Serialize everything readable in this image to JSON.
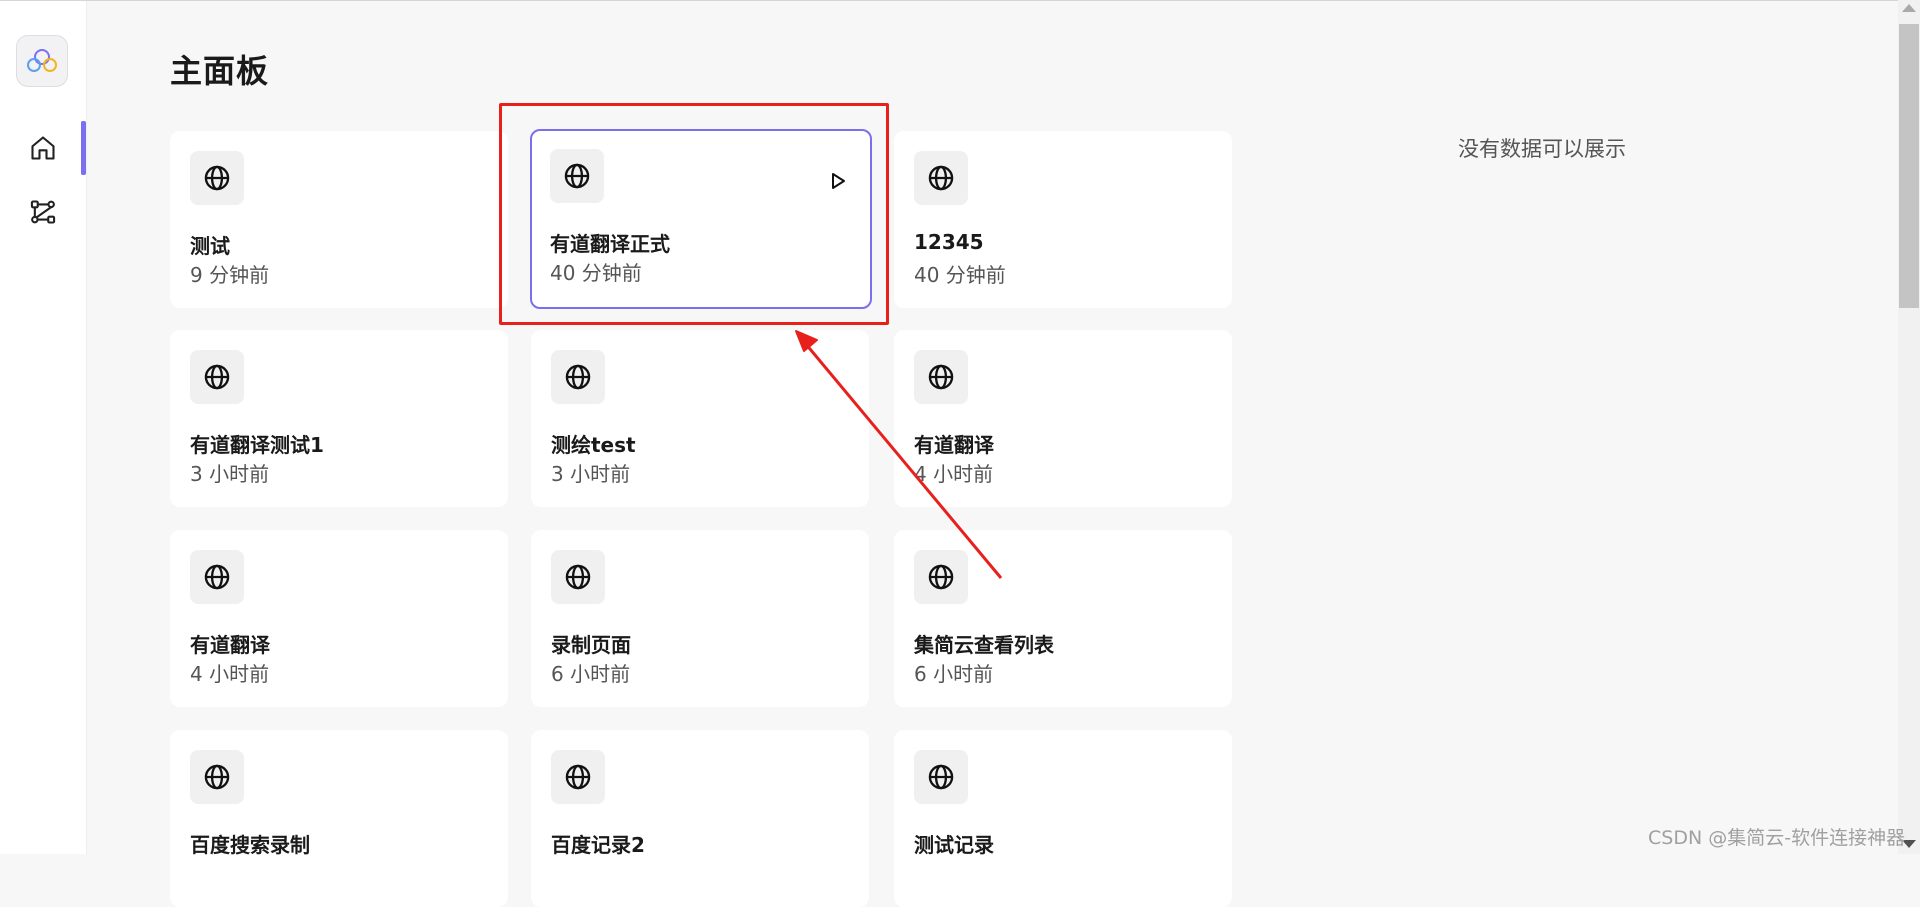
{
  "app": {
    "page_title": "主面板",
    "nav": [
      {
        "icon": "home-icon",
        "active": true
      },
      {
        "icon": "workflow-icon",
        "active": false
      }
    ]
  },
  "empty_state": "没有数据可以展示",
  "cards": [
    {
      "name": "测试",
      "time": "9 分钟前",
      "icon": "globe-icon"
    },
    {
      "name": "有道翻译正式",
      "time": "40 分钟前",
      "icon": "globe-icon",
      "selected": true,
      "action_icon": "play-icon"
    },
    {
      "name": "12345",
      "time": "40 分钟前",
      "icon": "globe-icon"
    },
    {
      "name": "有道翻译测试1",
      "time": "3 小时前",
      "icon": "globe-icon"
    },
    {
      "name": "测绘test",
      "time": "3 小时前",
      "icon": "globe-icon"
    },
    {
      "name": "有道翻译",
      "time": "4 小时前",
      "icon": "globe-icon"
    },
    {
      "name": "有道翻译",
      "time": "4 小时前",
      "icon": "globe-icon"
    },
    {
      "name": "录制页面",
      "time": "6 小时前",
      "icon": "globe-icon"
    },
    {
      "name": "集简云查看列表",
      "time": "6 小时前",
      "icon": "globe-icon"
    },
    {
      "name": "百度搜索录制",
      "time": "",
      "icon": "globe-icon"
    },
    {
      "name": "百度记录2",
      "time": "",
      "icon": "globe-icon"
    },
    {
      "name": "测试记录",
      "time": "",
      "icon": "globe-icon"
    }
  ],
  "watermark": "CSDN @集简云-软件连接神器",
  "colors": {
    "accent": "#7b6ff0",
    "annotation": "#e8201c",
    "background": "#f7f7f7",
    "card": "#ffffff"
  }
}
